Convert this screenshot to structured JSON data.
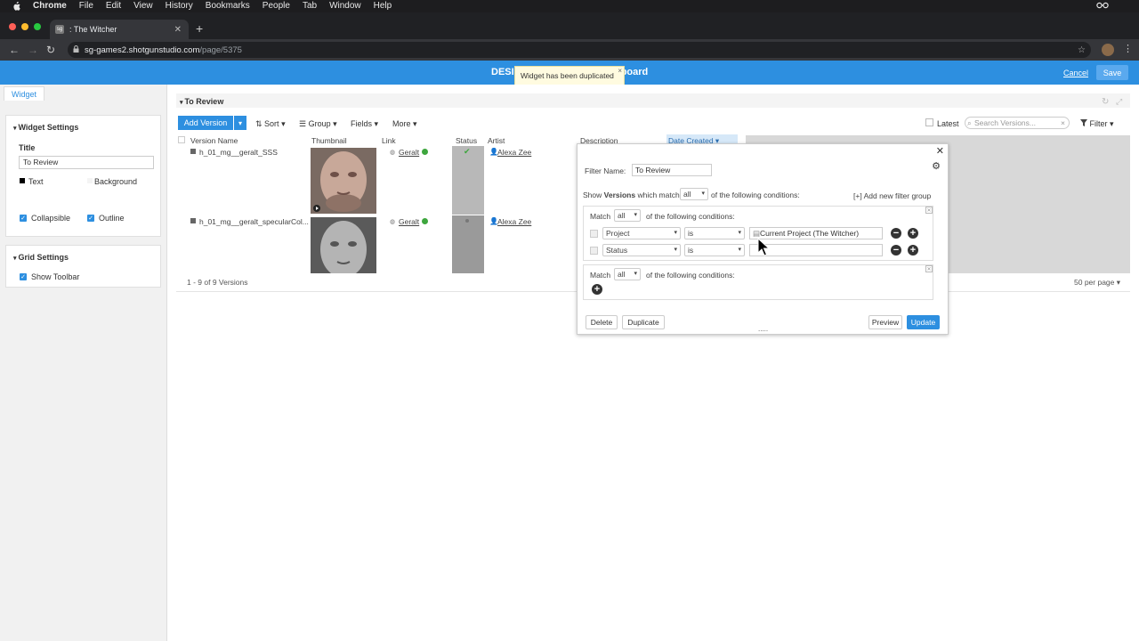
{
  "macbar": {
    "menus": [
      "Chrome",
      "File",
      "Edit",
      "View",
      "History",
      "Bookmarks",
      "People",
      "Tab",
      "Window",
      "Help"
    ]
  },
  "browser": {
    "tab_title": ": The Witcher",
    "favicon_text": "sg",
    "url_host": "sg-games2.shotgunstudio.com",
    "url_path": "/page/5375"
  },
  "header": {
    "title": "DESI",
    "title_tail": "board",
    "cancel_label": "Cancel",
    "save_label": "Save",
    "toast": "Widget has been duplicated"
  },
  "left_panel": {
    "tab_label": "Widget",
    "widget_settings": {
      "heading": "Widget Settings",
      "title_label": "Title",
      "title_value": "To Review",
      "text_label": "Text",
      "background_label": "Background",
      "collapsible_label": "Collapsible",
      "outline_label": "Outline"
    },
    "grid_settings": {
      "heading": "Grid Settings",
      "show_toolbar_label": "Show Toolbar"
    }
  },
  "main": {
    "section_title": "To Review",
    "toolbar": {
      "add_version": "Add Version",
      "sort": "Sort",
      "group": "Group",
      "fields": "Fields",
      "more": "More",
      "latest": "Latest",
      "search_placeholder": "Search Versions...",
      "filter": "Filter"
    },
    "columns": [
      "Version Name",
      "Thumbnail",
      "Link",
      "Status",
      "Artist",
      "Description",
      "Date Created"
    ],
    "rows": [
      {
        "version_name": "h_01_mg__geralt_SSS",
        "link": "Geralt",
        "artist": "Alexa Zee",
        "status_color": "#b8b8b8"
      },
      {
        "version_name": "h_01_mg__geralt_specularCol...",
        "link": "Geralt",
        "artist": "Alexa Zee",
        "status_color": "#9a9a9a"
      }
    ],
    "footer_count": "1 - 9 of 9 Versions",
    "per_page": "50 per page"
  },
  "filter": {
    "name_label": "Filter Name:",
    "name_value": "To Review",
    "show_prefix": "Show",
    "show_entity": "Versions",
    "show_mid": "which match",
    "show_match": "all",
    "show_suffix": "of the following conditions:",
    "add_group": "[+] Add new filter group",
    "group1": {
      "match_label": "Match",
      "match_value": "all",
      "suffix": "of the following conditions:",
      "conditions": [
        {
          "field": "Project",
          "op": "is",
          "value": "Current Project (The Witcher)"
        },
        {
          "field": "Status",
          "op": "is",
          "value": ""
        }
      ]
    },
    "group2": {
      "match_label": "Match",
      "match_value": "all",
      "suffix": "of the following conditions:"
    },
    "buttons": {
      "delete": "Delete",
      "duplicate": "Duplicate",
      "preview": "Preview",
      "update": "Update"
    },
    "resize_handle": "....."
  },
  "colors": {
    "accent": "#2d8fe0",
    "status_green": "#3ea63e"
  }
}
